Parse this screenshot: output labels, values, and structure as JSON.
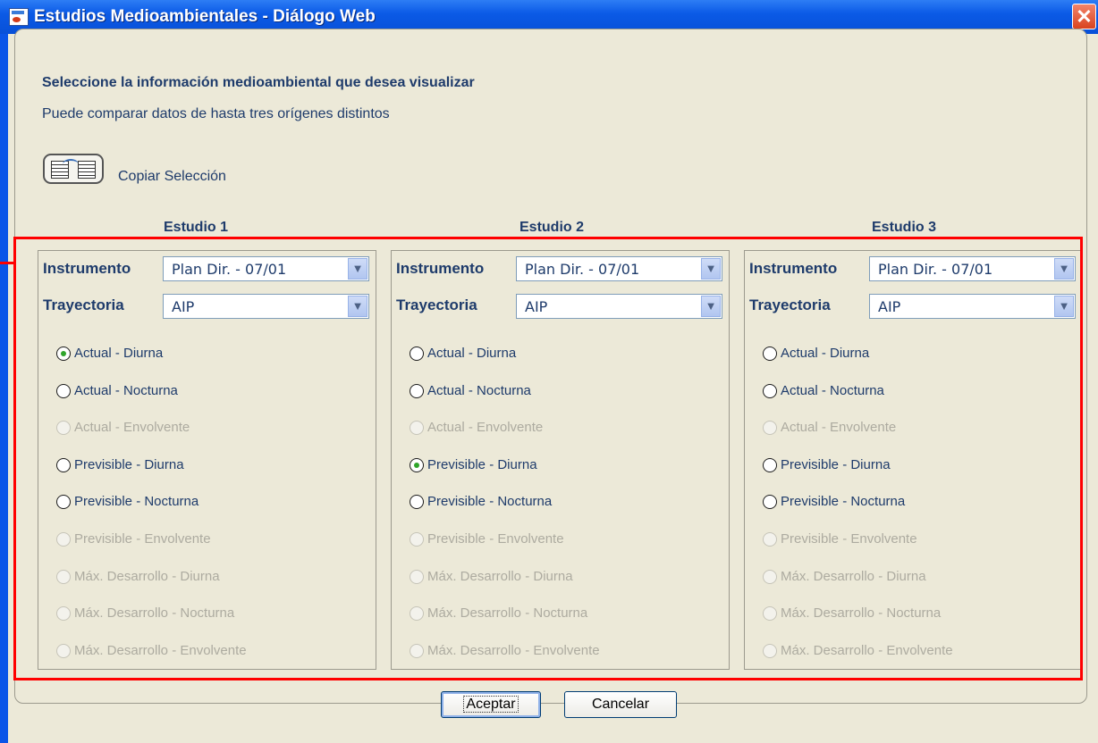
{
  "window": {
    "title": "Estudios Medioambientales - Diálogo Web",
    "close_label": "✕"
  },
  "header": {
    "heading": "Seleccione la información medioambiental que desea visualizar",
    "subheading": "Puede comparar datos de hasta tres orígenes distintos"
  },
  "toolbar": {
    "copy_label": "Copiar Selección",
    "copy_icon": "copy-selection-icon"
  },
  "labels": {
    "instrumento": "Instrumento",
    "trayectoria": "Trayectoria"
  },
  "studies": [
    {
      "title": "Estudio 1",
      "instrumento": "Plan Dir. - 07/01",
      "trayectoria": "AIP",
      "options": [
        {
          "label": "Actual - Diurna",
          "checked": true,
          "enabled": true
        },
        {
          "label": "Actual - Nocturna",
          "checked": false,
          "enabled": true
        },
        {
          "label": "Actual - Envolvente",
          "checked": false,
          "enabled": false
        },
        {
          "label": "Previsible - Diurna",
          "checked": false,
          "enabled": true
        },
        {
          "label": "Previsible - Nocturna",
          "checked": false,
          "enabled": true
        },
        {
          "label": "Previsible - Envolvente",
          "checked": false,
          "enabled": false
        },
        {
          "label": "Máx. Desarrollo - Diurna",
          "checked": false,
          "enabled": false
        },
        {
          "label": "Máx. Desarrollo - Nocturna",
          "checked": false,
          "enabled": false
        },
        {
          "label": "Máx. Desarrollo - Envolvente",
          "checked": false,
          "enabled": false
        }
      ]
    },
    {
      "title": "Estudio 2",
      "instrumento": "Plan Dir. - 07/01",
      "trayectoria": "AIP",
      "options": [
        {
          "label": "Actual - Diurna",
          "checked": false,
          "enabled": true
        },
        {
          "label": "Actual - Nocturna",
          "checked": false,
          "enabled": true
        },
        {
          "label": "Actual - Envolvente",
          "checked": false,
          "enabled": false
        },
        {
          "label": "Previsible - Diurna",
          "checked": true,
          "enabled": true
        },
        {
          "label": "Previsible - Nocturna",
          "checked": false,
          "enabled": true
        },
        {
          "label": "Previsible - Envolvente",
          "checked": false,
          "enabled": false
        },
        {
          "label": "Máx. Desarrollo - Diurna",
          "checked": false,
          "enabled": false
        },
        {
          "label": "Máx. Desarrollo - Nocturna",
          "checked": false,
          "enabled": false
        },
        {
          "label": "Máx. Desarrollo - Envolvente",
          "checked": false,
          "enabled": false
        }
      ]
    },
    {
      "title": "Estudio 3",
      "instrumento": "Plan Dir. - 07/01",
      "trayectoria": "AIP",
      "options": [
        {
          "label": "Actual - Diurna",
          "checked": false,
          "enabled": true
        },
        {
          "label": "Actual - Nocturna",
          "checked": false,
          "enabled": true
        },
        {
          "label": "Actual - Envolvente",
          "checked": false,
          "enabled": false
        },
        {
          "label": "Previsible - Diurna",
          "checked": false,
          "enabled": true
        },
        {
          "label": "Previsible - Nocturna",
          "checked": false,
          "enabled": true
        },
        {
          "label": "Previsible - Envolvente",
          "checked": false,
          "enabled": false
        },
        {
          "label": "Máx. Desarrollo - Diurna",
          "checked": false,
          "enabled": false
        },
        {
          "label": "Máx. Desarrollo - Nocturna",
          "checked": false,
          "enabled": false
        },
        {
          "label": "Máx. Desarrollo - Envolvente",
          "checked": false,
          "enabled": false
        }
      ]
    }
  ],
  "buttons": {
    "accept": "Aceptar",
    "cancel": "Cancelar"
  },
  "colors": {
    "highlight_frame": "#ff0000",
    "titlebar": "#0a55e8",
    "dialog_bg": "#ece9d8"
  }
}
